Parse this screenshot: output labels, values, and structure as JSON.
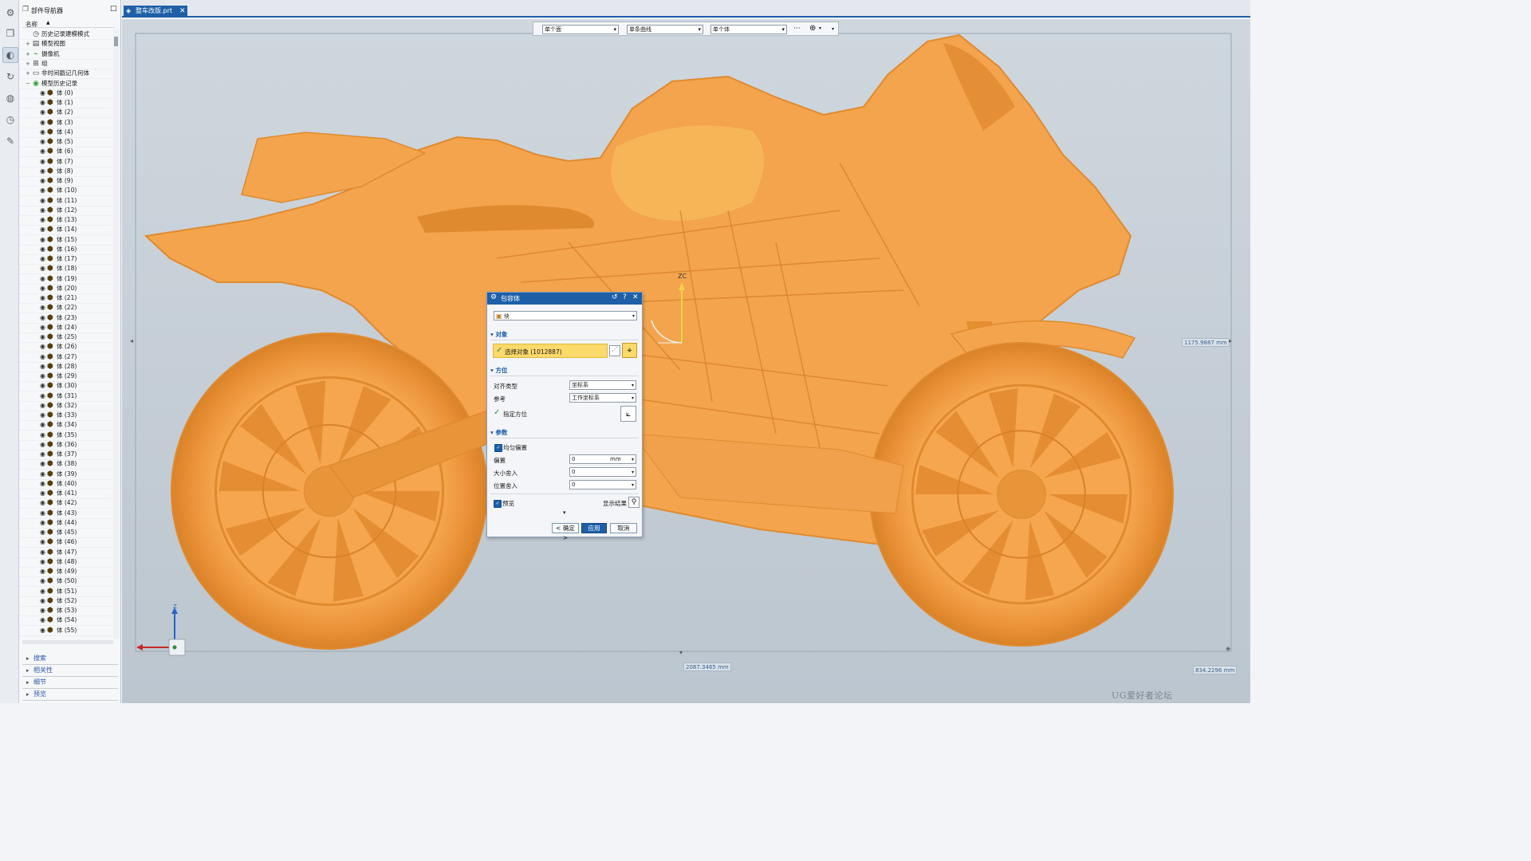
{
  "app": {
    "part_navigator_title": "部件导航器",
    "tab_file": "整车改版.prt",
    "column_name": "名称"
  },
  "rail": {
    "icons": [
      "gear-icon",
      "part-icon",
      "assembly-icon",
      "history-icon",
      "globe-icon",
      "clock-icon",
      "roles-icon"
    ]
  },
  "tree": {
    "nodes": [
      {
        "label": "历史记录建模模式",
        "icon": "clock",
        "indent": 0
      },
      {
        "label": "模型视图",
        "icon": "view",
        "indent": 0
      },
      {
        "label": "摄像机",
        "icon": "camera",
        "indent": 0
      },
      {
        "label": "组",
        "icon": "group",
        "indent": 0
      },
      {
        "label": "非时间戳记几何体",
        "icon": "folder",
        "indent": 0
      },
      {
        "label": "模型历史记录",
        "icon": "history",
        "indent": 0
      }
    ],
    "body_prefix": "体",
    "bodies": [
      "(0)",
      "(1)",
      "(2)",
      "(3)",
      "(4)",
      "(5)",
      "(6)",
      "(7)",
      "(8)",
      "(9)",
      "(10)",
      "(11)",
      "(12)",
      "(13)",
      "(14)",
      "(15)",
      "(16)",
      "(17)",
      "(18)",
      "(19)",
      "(20)",
      "(21)",
      "(22)",
      "(23)",
      "(24)",
      "(25)",
      "(26)",
      "(27)",
      "(28)",
      "(29)",
      "(30)",
      "(31)",
      "(32)",
      "(33)",
      "(34)",
      "(35)",
      "(36)",
      "(37)",
      "(38)",
      "(39)",
      "(40)",
      "(41)",
      "(42)",
      "(43)",
      "(44)",
      "(45)",
      "(46)",
      "(47)",
      "(48)",
      "(49)",
      "(50)",
      "(51)",
      "(52)",
      "(53)",
      "(54)",
      "(55)"
    ]
  },
  "panels": [
    "搜索",
    "相关性",
    "细节",
    "预览"
  ],
  "selection_bar": {
    "filter1": "单个面",
    "filter2": "单条曲线",
    "filter3": "单个体",
    "more": "···"
  },
  "dialog": {
    "title": "包容体",
    "type_value": "块",
    "sec_object": "对象",
    "select_label": "选择对象 (1012887)",
    "sec_orientation": "方位",
    "align_label": "对齐类型",
    "align_value": "坐标系",
    "ref_label": "参考",
    "ref_value": "工作坐标系",
    "specify_label": "指定方位",
    "sec_params": "参数",
    "uniform_label": "均匀偏置",
    "offset_label": "偏置",
    "offset_value": "0",
    "offset_unit": "mm",
    "size_round_label": "大小舍入",
    "size_round_value": "0",
    "pos_round_label": "位置舍入",
    "pos_round_value": "0",
    "preview_label": "预览",
    "show_result_label": "显示结果",
    "ok_label": "< 确定 >",
    "apply_label": "应用",
    "cancel_label": "取消"
  },
  "viewport": {
    "zc_label": "ZC",
    "dim_height": "1175.9887 mm",
    "dim_length": "2087.3465 mm",
    "dim_width": "834.2296 mm",
    "watermark": "UG爱好者论坛 WWW.UGSNX.COM",
    "axis_z": "Z",
    "model_color": "#f4a44c",
    "model_shade": "#e08a30"
  }
}
